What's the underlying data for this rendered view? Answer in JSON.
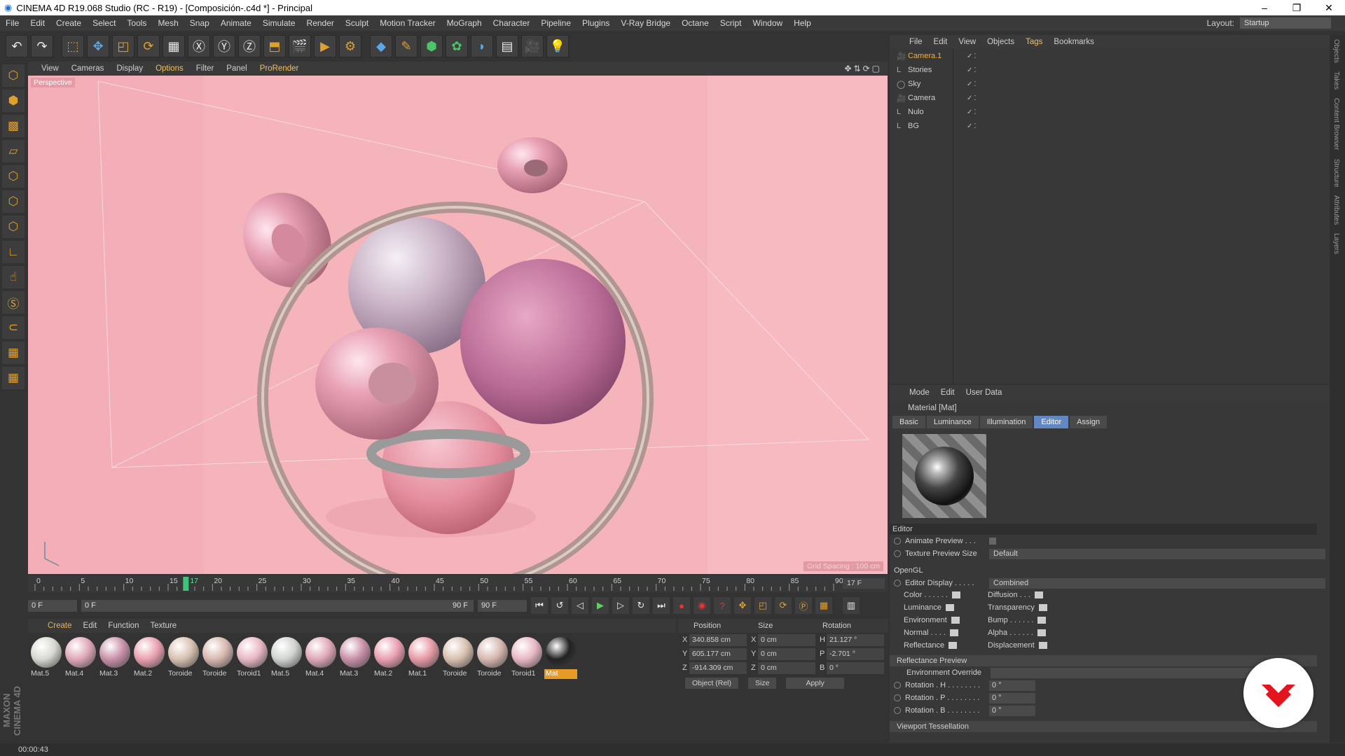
{
  "window": {
    "title": "CINEMA 4D R19.068 Studio (RC - R19) - [Composición-.c4d *] - Principal",
    "min": "–",
    "max": "❐",
    "close": "✕"
  },
  "menubar": {
    "items": [
      "File",
      "Edit",
      "Create",
      "Select",
      "Tools",
      "Mesh",
      "Snap",
      "Animate",
      "Simulate",
      "Render",
      "Sculpt",
      "Motion Tracker",
      "MoGraph",
      "Character",
      "Pipeline",
      "Plugins",
      "V-Ray Bridge",
      "Octane",
      "Script",
      "Window",
      "Help"
    ],
    "layout_label": "Layout:",
    "layout_value": "Startup"
  },
  "viewport": {
    "menu": [
      "View",
      "Cameras",
      "Display",
      "Options",
      "Filter",
      "Panel",
      "ProRender"
    ],
    "label": "Perspective",
    "grid": "Grid Spacing : 100 cm"
  },
  "timeline": {
    "ticks": [
      "0",
      "5",
      "10",
      "15",
      "20",
      "25",
      "30",
      "35",
      "40",
      "45",
      "50",
      "55",
      "60",
      "65",
      "70",
      "75",
      "80",
      "85",
      "90"
    ],
    "current_marker": "17",
    "frame_box": "17 F",
    "start": "0 F",
    "slider_start": "0 F",
    "slider_end": "90 F",
    "end": "90 F",
    "current_frame": 17
  },
  "materials": {
    "menu": [
      "Create",
      "Edit",
      "Function",
      "Texture"
    ],
    "items": [
      {
        "name": "Mat.5",
        "color": "#d8d8d2"
      },
      {
        "name": "Mat.4",
        "color": "#e0a8b8"
      },
      {
        "name": "Mat.3",
        "color": "#c890a8"
      },
      {
        "name": "Mat.2",
        "color": "#eaa0b0"
      },
      {
        "name": "Toroide",
        "color": "#d8c0b0"
      },
      {
        "name": "Toroide",
        "color": "#d8b8b0"
      },
      {
        "name": "Toroid1",
        "color": "#e8b8c4"
      },
      {
        "name": "Mat.5",
        "color": "#d0d4d0"
      },
      {
        "name": "Mat.4",
        "color": "#e0a8b8"
      },
      {
        "name": "Mat.3",
        "color": "#c890a8"
      },
      {
        "name": "Mat.2",
        "color": "#eaa0b0"
      },
      {
        "name": "Mat.1",
        "color": "#e89aa6"
      },
      {
        "name": "Toroide",
        "color": "#d8c0b0"
      },
      {
        "name": "Toroide",
        "color": "#d8b8b0"
      },
      {
        "name": "Toroid1",
        "color": "#e8b8c4"
      },
      {
        "name": "Mat",
        "color": "#222222"
      }
    ]
  },
  "coords": {
    "headers": [
      "Position",
      "Size",
      "Rotation"
    ],
    "rows": [
      {
        "pos_axis": "X",
        "pos": "340.858 cm",
        "size_axis": "X",
        "size": "0 cm",
        "rot_axis": "H",
        "rot": "21.127 °"
      },
      {
        "pos_axis": "Y",
        "pos": "605.177 cm",
        "size_axis": "Y",
        "size": "0 cm",
        "rot_axis": "P",
        "rot": "-2.701 °"
      },
      {
        "pos_axis": "Z",
        "pos": "-914.309 cm",
        "size_axis": "Z",
        "size": "0 cm",
        "rot_axis": "B",
        "rot": "0 °"
      }
    ],
    "mode": "Object (Rel)",
    "size_mode": "Size",
    "apply": "Apply"
  },
  "objects": {
    "menu": [
      "File",
      "Edit",
      "View",
      "Objects",
      "Tags",
      "Bookmarks"
    ],
    "items": [
      {
        "name": "Camera.1",
        "icon": "camera-icon"
      },
      {
        "name": "Stories",
        "icon": "null-icon"
      },
      {
        "name": "Sky",
        "icon": "sky-icon"
      },
      {
        "name": "Camera",
        "icon": "camera-icon"
      },
      {
        "name": "Nulo",
        "icon": "null-icon"
      },
      {
        "name": "BG",
        "icon": "null-icon"
      }
    ]
  },
  "attributes": {
    "menu": [
      "Mode",
      "Edit",
      "User Data"
    ],
    "title": "Material [Mat]",
    "tabs": [
      "Basic",
      "Luminance",
      "Illumination",
      "Editor",
      "Assign"
    ],
    "active_tab": "Editor",
    "section": "Editor",
    "animate_preview": "Animate Preview . . .",
    "texture_size_label": "Texture Preview Size",
    "texture_size": "Default",
    "opengl": "OpenGL",
    "editor_display_label": "Editor Display . . . . .",
    "editor_display": "Combined",
    "channels_left": [
      "Color . . . . . .",
      "Luminance",
      "Environment",
      "Normal . . . .",
      "Reflectance"
    ],
    "channels_right": [
      "Diffusion . . .",
      "Transparency",
      "Bump . . . . . .",
      "Alpha . . . . . .",
      "Displacement"
    ],
    "reflectance_preview": "Reflectance Preview",
    "env_override": "Environment Override",
    "rot_h_label": "Rotation . H . . . . . . . .",
    "rot_h": "0 °",
    "rot_p_label": "Rotation . P . . . . . . . .",
    "rot_p": "0 °",
    "rot_b_label": "Rotation . B . . . . . . . .",
    "rot_b": "0 °",
    "viewport_tess": "Viewport Tessellation"
  },
  "status": {
    "time": "00:00:43"
  },
  "right_tabs": [
    "Objects",
    "Takes",
    "Content Browser",
    "Structure",
    "Attributes",
    "Layers"
  ],
  "brand": {
    "maxon": "MAXON CINEMA 4D"
  }
}
